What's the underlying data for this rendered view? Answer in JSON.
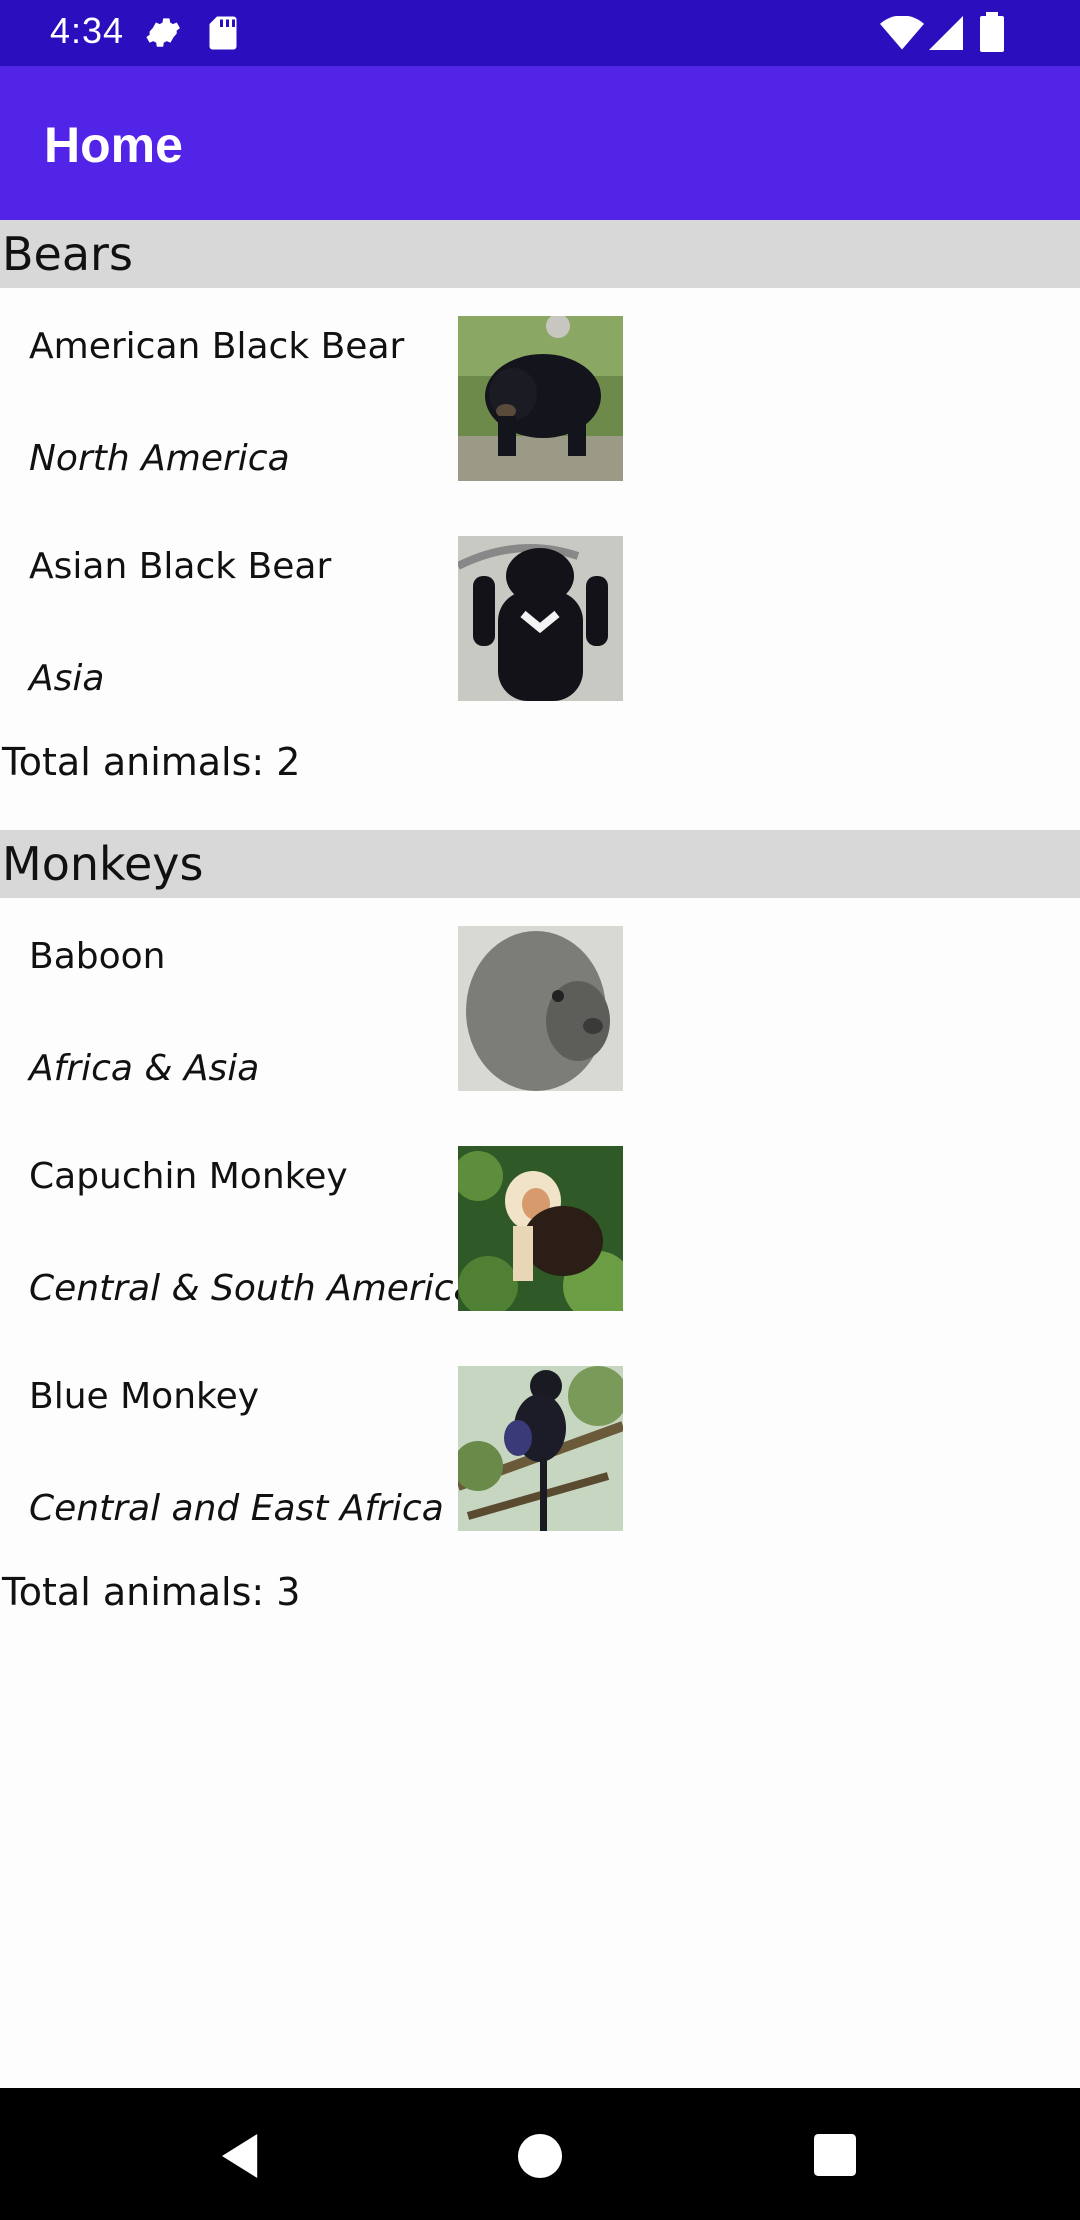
{
  "status_bar": {
    "time": "4:34",
    "icons": [
      "settings-icon",
      "sd-card-icon",
      "wifi-icon",
      "signal-icon",
      "battery-icon"
    ]
  },
  "app_bar": {
    "title": "Home",
    "color": "#5224e8",
    "status_color": "#2b0fbe"
  },
  "groups": [
    {
      "name": "Bears",
      "animals": [
        {
          "name": "American Black Bear",
          "location": "North America",
          "image": "black-bear-photo"
        },
        {
          "name": "Asian Black Bear",
          "location": "Asia",
          "image": "asian-black-bear-photo"
        }
      ],
      "footer": "Total animals: 2"
    },
    {
      "name": "Monkeys",
      "animals": [
        {
          "name": "Baboon",
          "location": "Africa & Asia",
          "image": "baboon-photo"
        },
        {
          "name": "Capuchin Monkey",
          "location": "Central & South America",
          "image": "capuchin-photo"
        },
        {
          "name": "Blue Monkey",
          "location": "Central and East Africa",
          "image": "blue-monkey-photo"
        }
      ],
      "footer": "Total animals: 3"
    }
  ],
  "nav_bar": {
    "buttons": [
      "back-icon",
      "home-icon",
      "recents-icon"
    ]
  }
}
